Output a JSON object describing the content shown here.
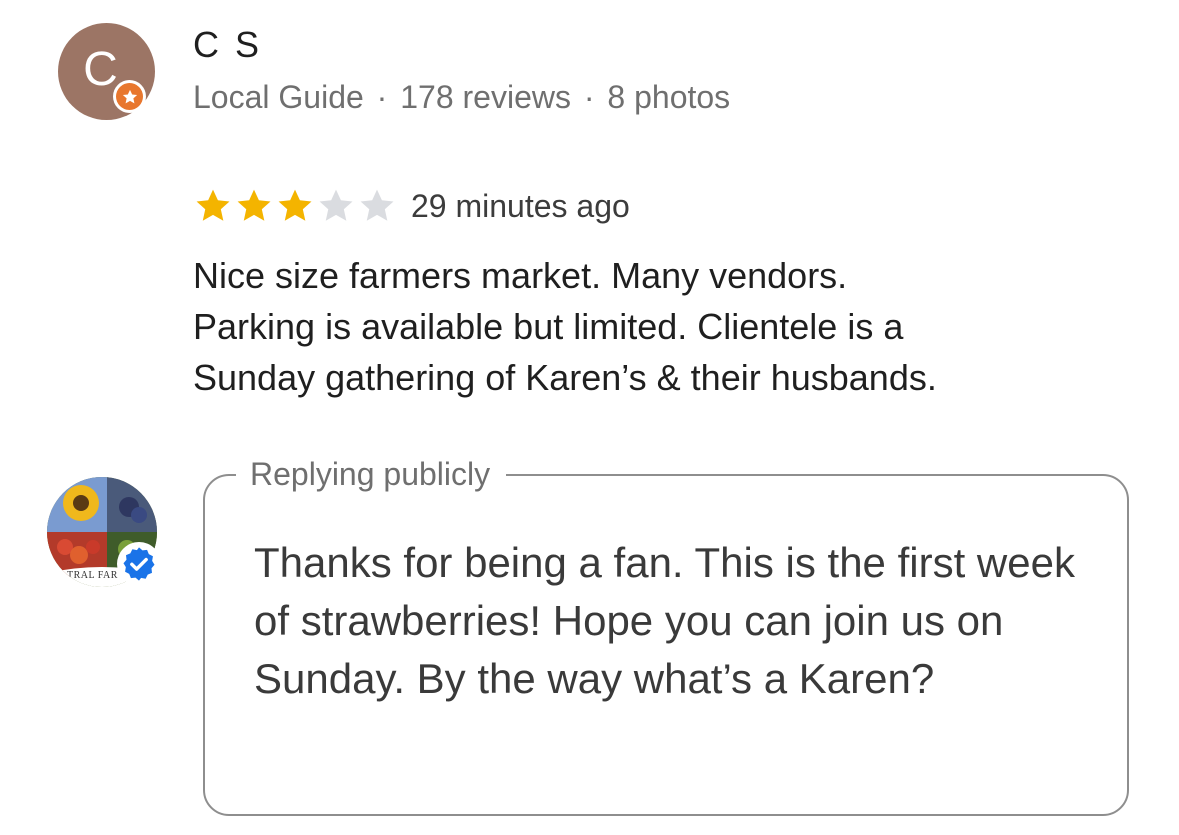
{
  "review": {
    "reviewer": {
      "initial": "C",
      "name": "C S",
      "label": "Local Guide",
      "reviews": "178 reviews",
      "photos": "8 photos",
      "separator": "·",
      "avatar_color": "#9c7565",
      "badge_color": "#e8772e"
    },
    "rating": {
      "value": 3,
      "max": 5,
      "filled_color": "#f4b400",
      "empty_color": "#dadce0"
    },
    "time_ago": "29 minutes ago",
    "text": "Nice size farmers market. Many vendors.\nParking is available but limited. Clientele is a\nSunday gathering of Karen’s & their husbands."
  },
  "reply": {
    "legend": "Replying publicly",
    "text": "Thanks for being a fan. This is the first week of strawberries! Hope you can join us on Sunday. By the way what’s a Karen?",
    "owner_avatar_caption": "TRAL FAR",
    "verified_color": "#1a73e8"
  }
}
